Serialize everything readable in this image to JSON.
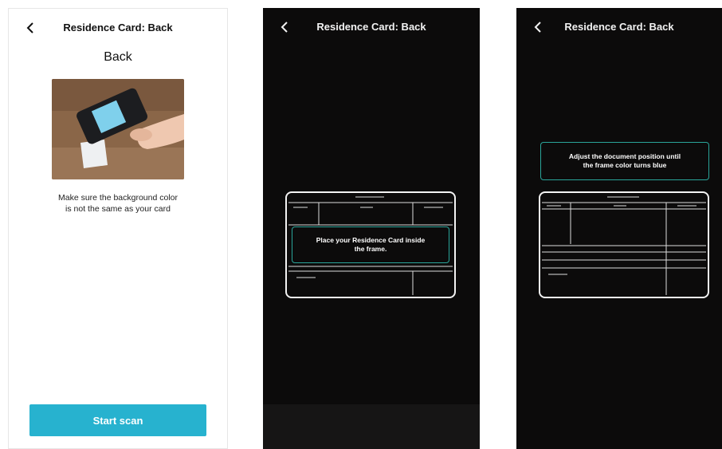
{
  "colors": {
    "accent": "#27b2cf",
    "dark_bg": "#0c0b0b",
    "frame": "#f3f3f3",
    "guide": "#2aa59a"
  },
  "screen1": {
    "title": "Residence Card: Back",
    "subtitle": "Back",
    "hint_lines": [
      "Make sure the background color",
      "is not the same as your card"
    ],
    "start_button": "Start scan"
  },
  "screen2": {
    "title": "Residence Card: Back",
    "message_lines": [
      "Place your Residence Card inside",
      "the frame."
    ]
  },
  "screen3": {
    "title": "Residence Card: Back",
    "message_lines": [
      "Adjust the document position until",
      "the frame color turns blue"
    ]
  }
}
